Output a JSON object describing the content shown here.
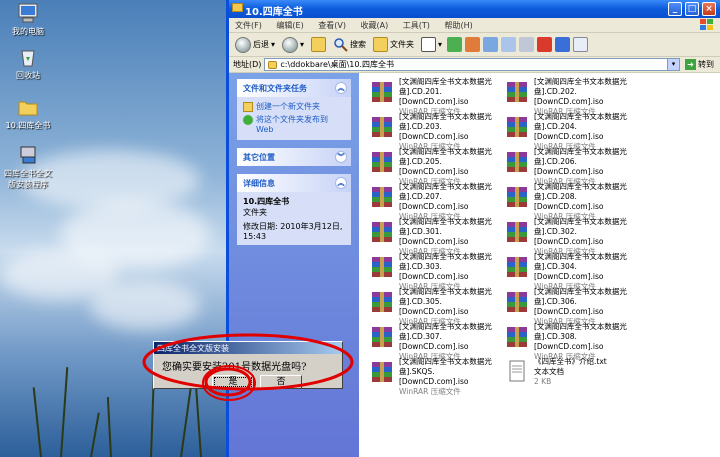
{
  "desktop": {
    "icons": [
      {
        "label": "我的电脑",
        "icon": "my-computer-icon"
      },
      {
        "label": "回收站",
        "icon": "recycle-bin-icon"
      },
      {
        "label": "10.四库全书",
        "icon": "folder-icon"
      },
      {
        "label": "四库全书全文版安装程序",
        "icon": "installer-icon"
      }
    ]
  },
  "window": {
    "title": "10.四库全书",
    "menu": [
      "文件(F)",
      "编辑(E)",
      "查看(V)",
      "收藏(A)",
      "工具(T)",
      "帮助(H)"
    ],
    "toolbar": {
      "back": "后退",
      "search": "搜索",
      "folders": "文件夹"
    },
    "address": {
      "label": "地址(D)",
      "value": "c:\\ddokbare\\桌面\\10.四库全书",
      "go": "转到"
    }
  },
  "tasks": {
    "file_tasks": {
      "title": "文件和文件夹任务",
      "items": [
        "创建一个新文件夹",
        "将这个文件夹发布到 Web"
      ]
    },
    "other_places": {
      "title": "其它位置"
    },
    "details": {
      "title": "详细信息",
      "name": "10.四库全书",
      "type": "文件夹",
      "modified": "修改日期: 2010年3月12日, 15:43"
    }
  },
  "files": [
    {
      "name1": "[文渊阁四库全书文本数据光",
      "name2": "盘].CD.201.[DownCD.com].iso",
      "type": "WinRAR 压缩文件"
    },
    {
      "name1": "[文渊阁四库全书文本数据光",
      "name2": "盘].CD.202.[DownCD.com].iso",
      "type": "WinRAR 压缩文件"
    },
    {
      "name1": "[文渊阁四库全书文本数据光",
      "name2": "盘].CD.203.[DownCD.com].iso",
      "type": "WinRAR 压缩文件"
    },
    {
      "name1": "[文渊阁四库全书文本数据光",
      "name2": "盘].CD.204.[DownCD.com].iso",
      "type": "WinRAR 压缩文件"
    },
    {
      "name1": "[文渊阁四库全书文本数据光",
      "name2": "盘].CD.205.[DownCD.com].iso",
      "type": "WinRAR 压缩文件"
    },
    {
      "name1": "[文渊阁四库全书文本数据光",
      "name2": "盘].CD.206.[DownCD.com].iso",
      "type": "WinRAR 压缩文件"
    },
    {
      "name1": "[文渊阁四库全书文本数据光",
      "name2": "盘].CD.207.[DownCD.com].iso",
      "type": "WinRAR 压缩文件"
    },
    {
      "name1": "[文渊阁四库全书文本数据光",
      "name2": "盘].CD.208.[DownCD.com].iso",
      "type": "WinRAR 压缩文件"
    },
    {
      "name1": "[文渊阁四库全书文本数据光",
      "name2": "盘].CD.301.[DownCD.com].iso",
      "type": "WinRAR 压缩文件"
    },
    {
      "name1": "[文渊阁四库全书文本数据光",
      "name2": "盘].CD.302.[DownCD.com].iso",
      "type": "WinRAR 压缩文件"
    },
    {
      "name1": "[文渊阁四库全书文本数据光",
      "name2": "盘].CD.303.[DownCD.com].iso",
      "type": "WinRAR 压缩文件"
    },
    {
      "name1": "[文渊阁四库全书文本数据光",
      "name2": "盘].CD.304.[DownCD.com].iso",
      "type": "WinRAR 压缩文件"
    },
    {
      "name1": "[文渊阁四库全书文本数据光",
      "name2": "盘].CD.305.[DownCD.com].iso",
      "type": "WinRAR 压缩文件"
    },
    {
      "name1": "[文渊阁四库全书文本数据光",
      "name2": "盘].CD.306.[DownCD.com].iso",
      "type": "WinRAR 压缩文件"
    },
    {
      "name1": "[文渊阁四库全书文本数据光",
      "name2": "盘].CD.307.[DownCD.com].iso",
      "type": "WinRAR 压缩文件"
    },
    {
      "name1": "[文渊阁四库全书文本数据光",
      "name2": "盘].CD.308.[DownCD.com].iso",
      "type": "WinRAR 压缩文件"
    },
    {
      "name1": "[文渊阁四库全书文本数据光",
      "name2": "盘].SKQS.[DownCD.com].iso",
      "type": "WinRAR 压缩文件"
    },
    {
      "name1": "《四库全书》介绍.txt",
      "name2": "文本文档",
      "type": "2 KB"
    }
  ],
  "dialog": {
    "title": "四库全书全文版安装",
    "message": "您确实要安装201号数据光盘吗?",
    "yes": "是",
    "no": "否"
  }
}
